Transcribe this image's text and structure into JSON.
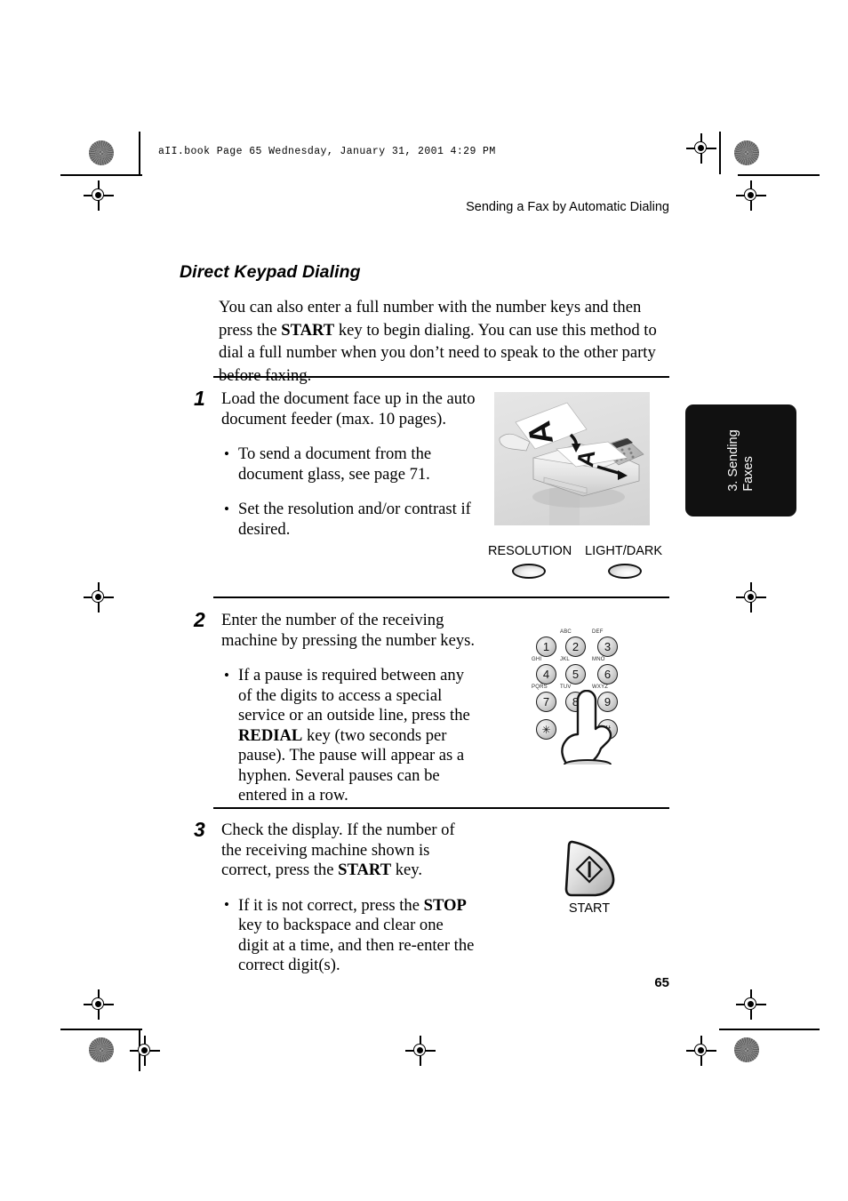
{
  "page": {
    "slugline": "aII.book  Page 65  Wednesday, January 31, 2001  4:29 PM",
    "running_head": "Sending a Fax by Automatic Dialing",
    "page_number": "65",
    "thumb_tab": "3. Sending\nFaxes"
  },
  "section": {
    "title": "Direct Keypad Dialing",
    "intro_part1": "You can also enter a full number with the number keys and then press the ",
    "intro_bold": "START",
    "intro_part2": " key to begin dialing. You can use this method to dial a full number when you don’t need to speak to the other party before faxing."
  },
  "steps": [
    {
      "number": "1",
      "text": "Load the document face up in the auto document feeder (max. 10 pages).",
      "bullets": [
        "To send a document from the document glass, see page 71.",
        "Set the resolution and/or contrast if desired."
      ]
    },
    {
      "number": "2",
      "text": "Enter the number of the receiving machine by pressing the number keys.",
      "bullet_part1": "If a pause is required between any of the digits to access a special service or an outside line, press the ",
      "bullet_bold": "REDIAL",
      "bullet_part2": " key (two seconds per pause). The pause will appear as a hyphen. Several pauses can be entered in a row."
    },
    {
      "number": "3",
      "text_part1": "Check the display. If the number of the receiving machine shown is correct, press the ",
      "text_bold": "START",
      "text_part2": " key.",
      "bullet_part1": "If it is not correct, press the ",
      "bullet_bold": "STOP",
      "bullet_part2": " key to backspace and clear one digit at a time, and then re-enter the correct digit(s)."
    }
  ],
  "figures": {
    "panel_buttons": [
      {
        "label": "RESOLUTION"
      },
      {
        "label": "LIGHT/DARK"
      }
    ],
    "keypad": {
      "keys": [
        {
          "digit": "1",
          "letters": ""
        },
        {
          "digit": "2",
          "letters": "ABC"
        },
        {
          "digit": "3",
          "letters": "DEF"
        },
        {
          "digit": "4",
          "letters": "GHI"
        },
        {
          "digit": "5",
          "letters": "JKL"
        },
        {
          "digit": "6",
          "letters": "MNO"
        },
        {
          "digit": "7",
          "letters": "PQRS"
        },
        {
          "digit": "8",
          "letters": "TUV"
        },
        {
          "digit": "9",
          "letters": "WXYZ"
        },
        {
          "digit": "✳",
          "letters": ""
        },
        {
          "digit": "#",
          "letters": ""
        }
      ]
    },
    "start_key": {
      "label": "START"
    },
    "document_letters": {
      "top_sheet": "A",
      "bottom_sheet": "A"
    }
  }
}
